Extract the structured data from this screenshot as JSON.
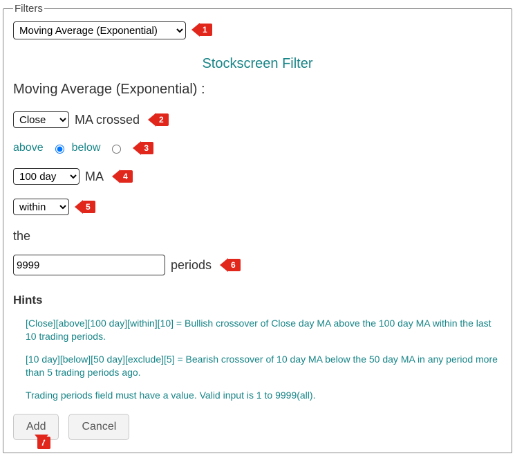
{
  "legend": "Filters",
  "filterSelect": {
    "selected": "Moving Average (Exponential)"
  },
  "title": "Stockscreen Filter",
  "subtitle": "Moving Average (Exponential) :",
  "priceField": {
    "selected": "Close"
  },
  "maCrossedLabel": "MA crossed",
  "direction": {
    "aboveLabel": "above",
    "belowLabel": "below",
    "selected": "above"
  },
  "periodSelect": {
    "selected": "100 day"
  },
  "maLabel": "MA",
  "conditionSelect": {
    "selected": "within"
  },
  "theLabel": "the",
  "periodsInput": {
    "value": "9999"
  },
  "periodsLabel": "periods",
  "hintsHeader": "Hints",
  "hints": {
    "h1": "[Close][above][100 day][within][10] = Bullish crossover of Close day MA above the 100 day MA within the last 10 trading periods.",
    "h2": "[10 day][below][50 day][exclude][5] = Bearish crossover of 10 day MA below the 50 day MA in any period more than 5 trading periods ago.",
    "h3": "Trading periods field must have a value. Valid input is 1 to 9999(all)."
  },
  "buttons": {
    "add": "Add",
    "cancel": "Cancel"
  },
  "markers": {
    "m1": "1",
    "m2": "2",
    "m3": "3",
    "m4": "4",
    "m5": "5",
    "m6": "6",
    "m7": "7"
  }
}
